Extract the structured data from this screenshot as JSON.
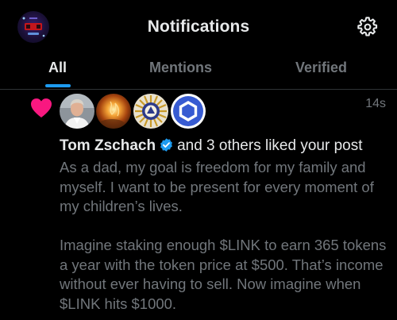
{
  "header": {
    "title": "Notifications",
    "profile_avatar_icon": "profile-avatar",
    "settings_icon": "gear-icon"
  },
  "tabs": [
    {
      "label": "All",
      "active": true
    },
    {
      "label": "Mentions",
      "active": false
    },
    {
      "label": "Verified",
      "active": false
    }
  ],
  "notification": {
    "type_icon": "heart-icon",
    "timestamp": "14s",
    "user_name": "Tom Zschach",
    "verified": true,
    "action_text": "and 3 others liked your post",
    "liker_avatars": [
      "person-avatar",
      "fire-avatar",
      "emblem-avatar",
      "chainlink-avatar"
    ],
    "post_text": "As a dad, my goal is freedom for my family and myself. I want to be present for every moment of my children’s lives.\n\nImagine staking enough $LINK to earn 365 tokens a year with the token price at $500. That’s income without ever having to sell. Now imagine when $LINK hits $1000."
  },
  "colors": {
    "background": "#000000",
    "accent": "#1d9bf0",
    "heart": "#f91880",
    "primary_text": "#e7e9ea",
    "secondary_text": "#71767b",
    "chainlink_blue": "#375bd2"
  }
}
